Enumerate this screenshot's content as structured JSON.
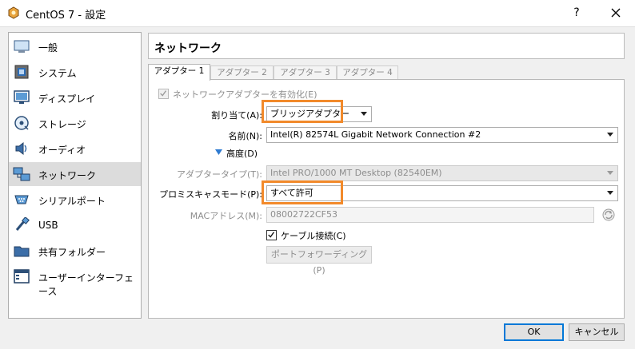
{
  "window": {
    "title": "CentOS 7 - 設定",
    "help_label": "?"
  },
  "sidebar": {
    "items": [
      {
        "label": "一般",
        "icon": "general-icon"
      },
      {
        "label": "システム",
        "icon": "system-icon"
      },
      {
        "label": "ディスプレイ",
        "icon": "display-icon"
      },
      {
        "label": "ストレージ",
        "icon": "storage-icon"
      },
      {
        "label": "オーディオ",
        "icon": "audio-icon"
      },
      {
        "label": "ネットワーク",
        "icon": "network-icon",
        "selected": true
      },
      {
        "label": "シリアルポート",
        "icon": "serial-port-icon"
      },
      {
        "label": "USB",
        "icon": "usb-icon"
      },
      {
        "label": "共有フォルダー",
        "icon": "shared-folder-icon"
      },
      {
        "label": "ユーザーインターフェース",
        "icon": "user-interface-icon"
      }
    ]
  },
  "page": {
    "title": "ネットワーク"
  },
  "tabs": [
    "アダプター 1",
    "アダプター 2",
    "アダプター 3",
    "アダプター 4"
  ],
  "adapter": {
    "enable_label": "ネットワークアダプターを有効化(E)",
    "enable_checked": true,
    "attached_label": "割り当て(A):",
    "attached_value": "ブリッジアダプター",
    "name_label": "名前(N):",
    "name_value": "Intel(R) 82574L Gigabit Network Connection #2",
    "advanced_label": "高度(D)",
    "adapter_type_label": "アダプタータイプ(T):",
    "adapter_type_value": "Intel PRO/1000 MT Desktop (82540EM)",
    "promisc_label": "プロミスキャスモード(P):",
    "promisc_value": "すべて許可",
    "mac_label": "MACアドレス(M):",
    "mac_value": "08002722CF53",
    "cable_label": "ケーブル接続(C)",
    "cable_checked": true,
    "port_forward_label": "ポートフォワーディング(P)"
  },
  "footer": {
    "ok_label": "OK",
    "cancel_label": "キャンセル"
  },
  "colors": {
    "highlight": "#f28a2b",
    "accent": "#0078d7"
  }
}
